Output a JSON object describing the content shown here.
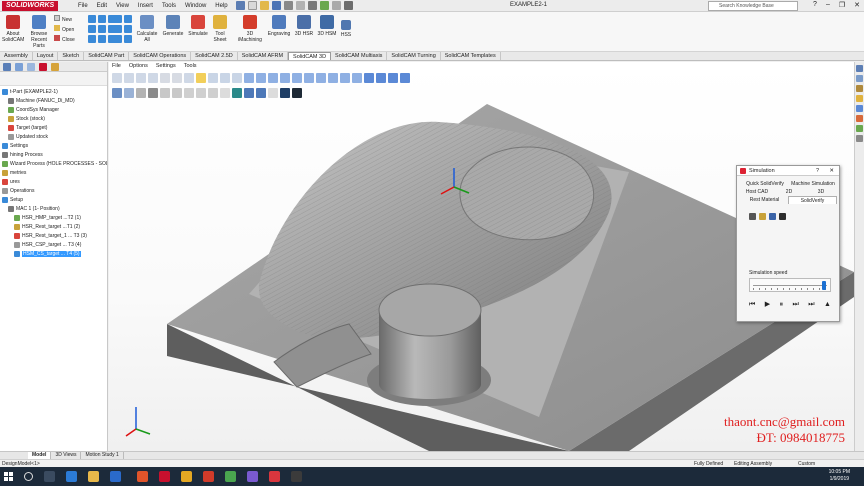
{
  "app": {
    "logo_text": "SOLIDWORKS",
    "document_title": "EXAMPLE2-1",
    "menus": [
      "File",
      "Edit",
      "View",
      "Insert",
      "Tools",
      "Window",
      "Help"
    ],
    "search_placeholder": "Search Knowledge Base",
    "window_controls": [
      "?",
      "–",
      "❐",
      "✕"
    ]
  },
  "ribbon": {
    "buttons": [
      {
        "label": "About SolidCAM",
        "icon": "solidcam-about-icon"
      },
      {
        "label": "Browse Recent Parts",
        "icon": "browse-icon"
      },
      {
        "label": "New",
        "icon": "new-icon"
      },
      {
        "label": "Open",
        "icon": "open-icon"
      },
      {
        "label": "Close",
        "icon": "close-icon"
      },
      {
        "label": "Calculate All",
        "icon": "calculate-icon"
      },
      {
        "label": "Generate",
        "icon": "generate-icon"
      },
      {
        "label": "Simulate",
        "icon": "simulate-icon"
      },
      {
        "label": "Tool Sheet",
        "icon": "toolsheet-icon"
      },
      {
        "label": "3D iMachining",
        "icon": "imachining-icon"
      },
      {
        "label": "Engraving",
        "icon": "engraving-icon"
      },
      {
        "label": "3D HSR",
        "icon": "hsr-icon"
      },
      {
        "label": "3D HSM",
        "icon": "hsm-icon"
      },
      {
        "label": "HSS",
        "icon": "hss-icon"
      }
    ],
    "tabs": [
      "Assembly",
      "Layout",
      "Sketch",
      "SolidCAM Part",
      "SolidCAM Operations",
      "SolidCAM 2.5D",
      "SolidCAM AFRM",
      "SolidCAM 3D",
      "SolidCAM Multiaxis",
      "SolidCAM Turning",
      "SolidCAM Templates"
    ],
    "active_tab": "SolidCAM 3D"
  },
  "tree": {
    "items": [
      {
        "label": "t-Part (EXAMPLE2-1)",
        "indent": 0
      },
      {
        "label": "Machine (FANUC_Di_MD)",
        "indent": 1
      },
      {
        "label": "CoordSys Manager",
        "indent": 1
      },
      {
        "label": "Stock (stock)",
        "indent": 1
      },
      {
        "label": "Target (target)",
        "indent": 1
      },
      {
        "label": "Updated stock",
        "indent": 1
      },
      {
        "label": "Settings",
        "indent": 0
      },
      {
        "label": "hining Process",
        "indent": 0
      },
      {
        "label": "Wizard Process (HOLE PROCESSES - SOLIDWO",
        "indent": 0
      },
      {
        "label": "metries",
        "indent": 0
      },
      {
        "label": "ures",
        "indent": 0
      },
      {
        "label": "Operations",
        "indent": 0
      },
      {
        "label": "Setup",
        "indent": 0
      },
      {
        "label": "MAC 1 (1- Position)",
        "indent": 1
      },
      {
        "label": "HSR_HMP_target ...T2 (1)",
        "indent": 2
      },
      {
        "label": "HSR_Rest_target ...T1 (2)",
        "indent": 2
      },
      {
        "label": "HSR_Rest_target_1 ... T3 (3)",
        "indent": 2
      },
      {
        "label": "HSR_CSP_target ... T3 (4)",
        "indent": 2
      },
      {
        "label": "HSM_CS_target ... T4 (5)",
        "indent": 2
      }
    ],
    "selected_index": 18
  },
  "viewport": {
    "menus": [
      "File",
      "Options",
      "Settings",
      "Tools"
    ]
  },
  "simulation": {
    "title": "Simulation",
    "help": "?",
    "close": "✕",
    "tabs_row1": [
      "Quick SolidVerify",
      "Machine Simulation"
    ],
    "tabs_row2": [
      "Host CAD",
      "2D",
      "3D",
      "SolidVerify"
    ],
    "tabs_row3": [
      "Rest Material"
    ],
    "active_tab": "SolidVerify",
    "speed_label": "Simulation speed",
    "speed_level": 0.96,
    "controls": [
      "⏮",
      "▶",
      "⏸",
      "⏭",
      "⏭",
      "▲"
    ]
  },
  "bottom": {
    "tabs": [
      "Model",
      "3D Views",
      "Motion Study 1"
    ],
    "active_tab": "Model",
    "status_left": "DesignModel<1>",
    "status_mid": "Fully Defined",
    "status_mid2": "Editing Assembly",
    "status_right": "Custom"
  },
  "taskbar": {
    "time": "10:05 PM",
    "date": "1/9/2019"
  },
  "watermark": {
    "email": "thaont.cnc@gmail.com",
    "phone": "ĐT: 0984018775"
  },
  "colors": {
    "accent_red": "#c8102e",
    "highlight": "#3399ff",
    "watermark": "#e01f1f",
    "stock_gray": "#8f8f8f"
  }
}
